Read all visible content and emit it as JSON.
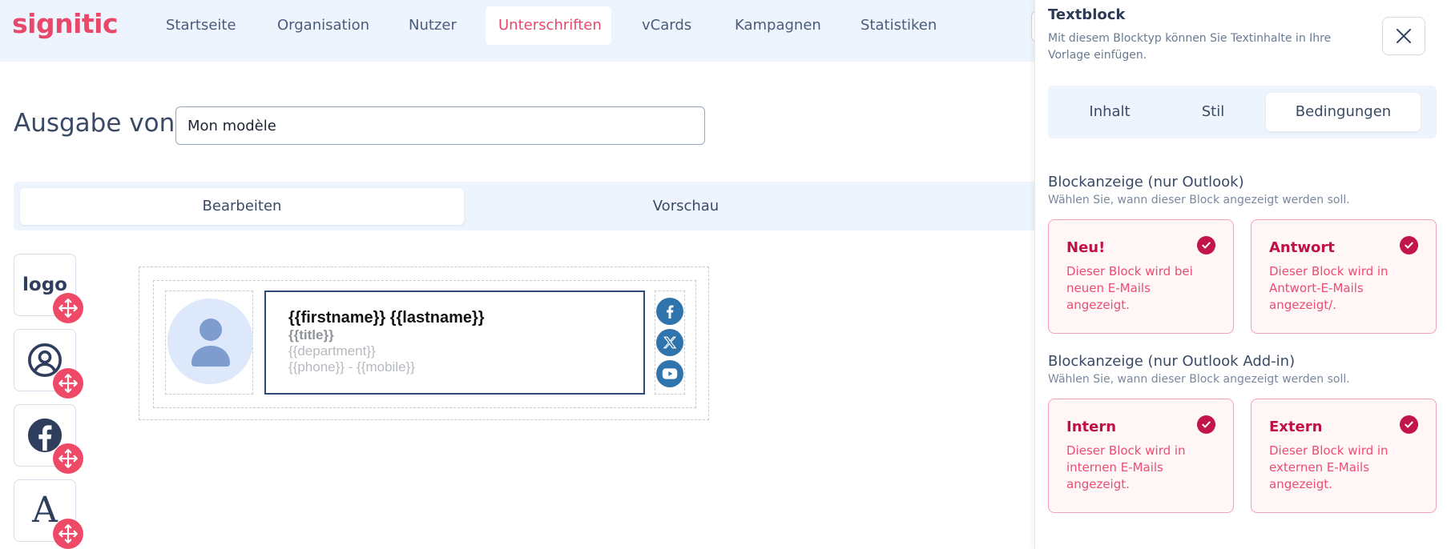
{
  "brand": {
    "name": "signitic"
  },
  "nav": {
    "items": [
      {
        "label": "Startseite"
      },
      {
        "label": "Organisation"
      },
      {
        "label": "Nutzer"
      },
      {
        "label": "Unterschriften"
      },
      {
        "label": "vCards"
      },
      {
        "label": "Kampagnen"
      },
      {
        "label": "Statistiken"
      }
    ],
    "active": "Unterschriften"
  },
  "editor": {
    "title_label": "Ausgabe von",
    "template_name": "Mon modèle",
    "tabs": [
      {
        "label": "Bearbeiten"
      },
      {
        "label": "Vorschau"
      }
    ],
    "active_tab": "Bearbeiten"
  },
  "palette": {
    "items": [
      {
        "label": "logo",
        "icon": "logo-block"
      },
      {
        "icon": "user-circle-icon"
      },
      {
        "icon": "facebook-icon"
      },
      {
        "label": "A",
        "icon": "text-block-icon"
      }
    ]
  },
  "signature": {
    "name": "{{firstname}} {{lastname}}",
    "title": "{{title}}",
    "department": "{{department}}",
    "phones": "{{phone}} - {{mobile}}",
    "social": [
      "facebook-icon",
      "x-icon",
      "youtube-icon"
    ],
    "social_color": "#2f74ac"
  },
  "panel": {
    "title": "Textblock",
    "description": "Mit diesem Blocktyp können Sie Textinhalte in Ihre Vorlage einfügen.",
    "tabs": [
      {
        "label": "Inhalt"
      },
      {
        "label": "Stil"
      },
      {
        "label": "Bedingungen"
      }
    ],
    "active_tab": "Bedingungen",
    "sections": [
      {
        "title": "Blockanzeige (nur Outlook)",
        "description": "Wählen Sie, wann dieser Block angezeigt werden soll.",
        "cards": [
          {
            "title": "Neu!",
            "description": "Dieser Block wird bei neuen E-Mails angezeigt.",
            "checked": true
          },
          {
            "title": "Antwort",
            "description": "Dieser Block wird in Antwort-E-Mails angezeigt/.",
            "checked": true
          }
        ]
      },
      {
        "title": "Blockanzeige (nur Outlook Add-in)",
        "description": "Wählen Sie, wann dieser Block angezeigt werden soll.",
        "cards": [
          {
            "title": "Intern",
            "description": "Dieser Block wird in internen E-Mails angezeigt.",
            "checked": true
          },
          {
            "title": "Extern",
            "description": "Dieser Block wird in externen E-Mails angezeigt.",
            "checked": true
          }
        ]
      }
    ]
  },
  "colors": {
    "accent": "#e9486a",
    "card_title": "#bf1048",
    "card_text": "#ec4d70",
    "nav_bg": "#eef4fd"
  }
}
